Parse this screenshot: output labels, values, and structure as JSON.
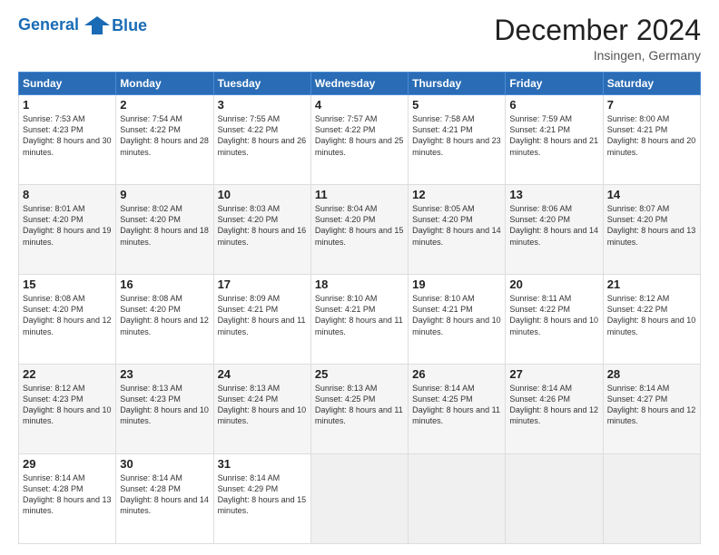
{
  "header": {
    "logo_line1": "General",
    "logo_line2": "Blue",
    "month_title": "December 2024",
    "location": "Insingen, Germany"
  },
  "days_of_week": [
    "Sunday",
    "Monday",
    "Tuesday",
    "Wednesday",
    "Thursday",
    "Friday",
    "Saturday"
  ],
  "weeks": [
    [
      {
        "day": "1",
        "sunrise": "7:53 AM",
        "sunset": "4:23 PM",
        "daylight": "8 hours and 30 minutes."
      },
      {
        "day": "2",
        "sunrise": "7:54 AM",
        "sunset": "4:22 PM",
        "daylight": "8 hours and 28 minutes."
      },
      {
        "day": "3",
        "sunrise": "7:55 AM",
        "sunset": "4:22 PM",
        "daylight": "8 hours and 26 minutes."
      },
      {
        "day": "4",
        "sunrise": "7:57 AM",
        "sunset": "4:22 PM",
        "daylight": "8 hours and 25 minutes."
      },
      {
        "day": "5",
        "sunrise": "7:58 AM",
        "sunset": "4:21 PM",
        "daylight": "8 hours and 23 minutes."
      },
      {
        "day": "6",
        "sunrise": "7:59 AM",
        "sunset": "4:21 PM",
        "daylight": "8 hours and 21 minutes."
      },
      {
        "day": "7",
        "sunrise": "8:00 AM",
        "sunset": "4:21 PM",
        "daylight": "8 hours and 20 minutes."
      }
    ],
    [
      {
        "day": "8",
        "sunrise": "8:01 AM",
        "sunset": "4:20 PM",
        "daylight": "8 hours and 19 minutes."
      },
      {
        "day": "9",
        "sunrise": "8:02 AM",
        "sunset": "4:20 PM",
        "daylight": "8 hours and 18 minutes."
      },
      {
        "day": "10",
        "sunrise": "8:03 AM",
        "sunset": "4:20 PM",
        "daylight": "8 hours and 16 minutes."
      },
      {
        "day": "11",
        "sunrise": "8:04 AM",
        "sunset": "4:20 PM",
        "daylight": "8 hours and 15 minutes."
      },
      {
        "day": "12",
        "sunrise": "8:05 AM",
        "sunset": "4:20 PM",
        "daylight": "8 hours and 14 minutes."
      },
      {
        "day": "13",
        "sunrise": "8:06 AM",
        "sunset": "4:20 PM",
        "daylight": "8 hours and 14 minutes."
      },
      {
        "day": "14",
        "sunrise": "8:07 AM",
        "sunset": "4:20 PM",
        "daylight": "8 hours and 13 minutes."
      }
    ],
    [
      {
        "day": "15",
        "sunrise": "8:08 AM",
        "sunset": "4:20 PM",
        "daylight": "8 hours and 12 minutes."
      },
      {
        "day": "16",
        "sunrise": "8:08 AM",
        "sunset": "4:20 PM",
        "daylight": "8 hours and 12 minutes."
      },
      {
        "day": "17",
        "sunrise": "8:09 AM",
        "sunset": "4:21 PM",
        "daylight": "8 hours and 11 minutes."
      },
      {
        "day": "18",
        "sunrise": "8:10 AM",
        "sunset": "4:21 PM",
        "daylight": "8 hours and 11 minutes."
      },
      {
        "day": "19",
        "sunrise": "8:10 AM",
        "sunset": "4:21 PM",
        "daylight": "8 hours and 10 minutes."
      },
      {
        "day": "20",
        "sunrise": "8:11 AM",
        "sunset": "4:22 PM",
        "daylight": "8 hours and 10 minutes."
      },
      {
        "day": "21",
        "sunrise": "8:12 AM",
        "sunset": "4:22 PM",
        "daylight": "8 hours and 10 minutes."
      }
    ],
    [
      {
        "day": "22",
        "sunrise": "8:12 AM",
        "sunset": "4:23 PM",
        "daylight": "8 hours and 10 minutes."
      },
      {
        "day": "23",
        "sunrise": "8:13 AM",
        "sunset": "4:23 PM",
        "daylight": "8 hours and 10 minutes."
      },
      {
        "day": "24",
        "sunrise": "8:13 AM",
        "sunset": "4:24 PM",
        "daylight": "8 hours and 10 minutes."
      },
      {
        "day": "25",
        "sunrise": "8:13 AM",
        "sunset": "4:25 PM",
        "daylight": "8 hours and 11 minutes."
      },
      {
        "day": "26",
        "sunrise": "8:14 AM",
        "sunset": "4:25 PM",
        "daylight": "8 hours and 11 minutes."
      },
      {
        "day": "27",
        "sunrise": "8:14 AM",
        "sunset": "4:26 PM",
        "daylight": "8 hours and 12 minutes."
      },
      {
        "day": "28",
        "sunrise": "8:14 AM",
        "sunset": "4:27 PM",
        "daylight": "8 hours and 12 minutes."
      }
    ],
    [
      {
        "day": "29",
        "sunrise": "8:14 AM",
        "sunset": "4:28 PM",
        "daylight": "8 hours and 13 minutes."
      },
      {
        "day": "30",
        "sunrise": "8:14 AM",
        "sunset": "4:28 PM",
        "daylight": "8 hours and 14 minutes."
      },
      {
        "day": "31",
        "sunrise": "8:14 AM",
        "sunset": "4:29 PM",
        "daylight": "8 hours and 15 minutes."
      },
      {
        "day": "",
        "sunrise": "",
        "sunset": "",
        "daylight": ""
      },
      {
        "day": "",
        "sunrise": "",
        "sunset": "",
        "daylight": ""
      },
      {
        "day": "",
        "sunrise": "",
        "sunset": "",
        "daylight": ""
      },
      {
        "day": "",
        "sunrise": "",
        "sunset": "",
        "daylight": ""
      }
    ]
  ]
}
